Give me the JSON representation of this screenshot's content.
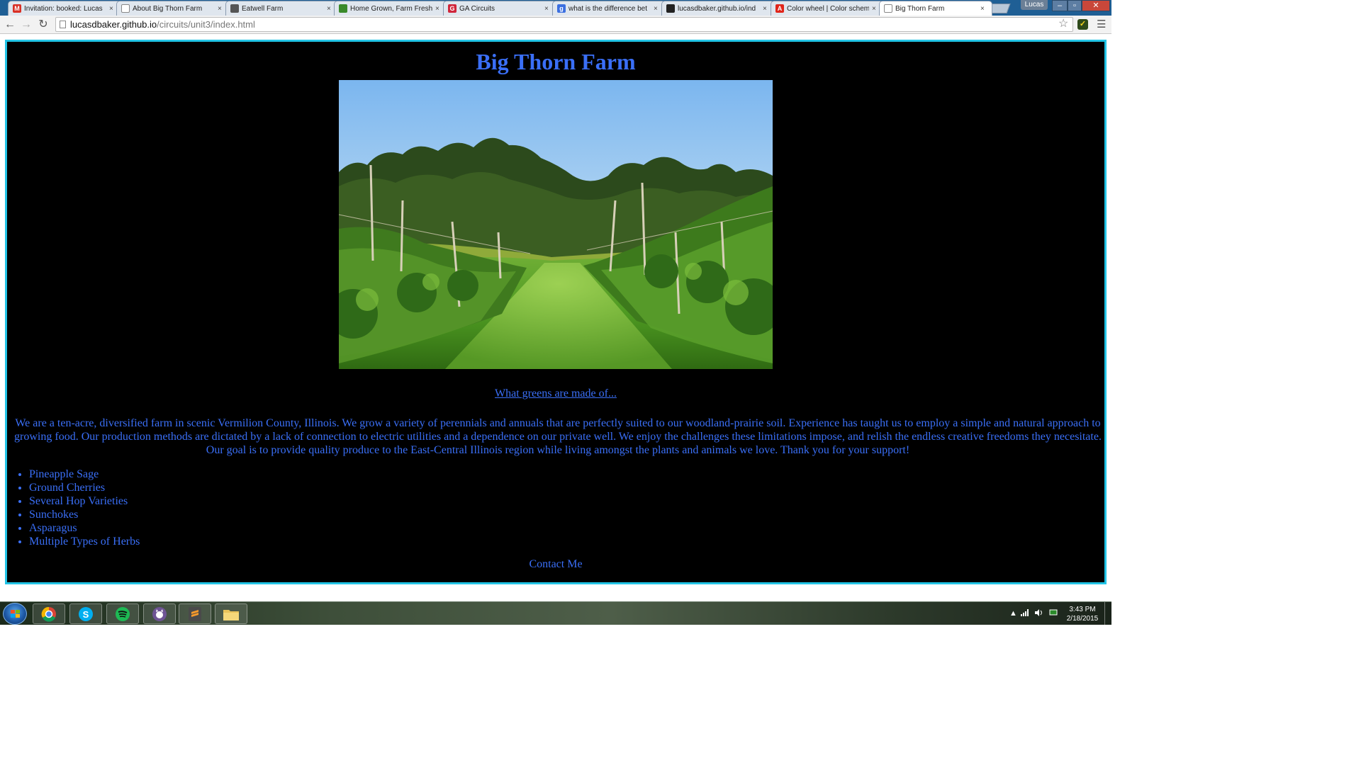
{
  "browser": {
    "tabs": [
      {
        "label": "Invitation: booked: Lucas",
        "favicon": "gmail-icon",
        "color": "#d93025",
        "glyph": "M"
      },
      {
        "label": "About Big Thorn Farm",
        "favicon": "page-icon",
        "color": "#ffffff",
        "glyph": ""
      },
      {
        "label": "Eatwell Farm",
        "favicon": "box-icon",
        "color": "#555555",
        "glyph": ""
      },
      {
        "label": "Home Grown, Farm Fresh",
        "favicon": "leaf-icon",
        "color": "#3a8a2a",
        "glyph": ""
      },
      {
        "label": "GA Circuits",
        "favicon": "ga-icon",
        "color": "#d0263b",
        "glyph": "G"
      },
      {
        "label": "what is the difference bet",
        "favicon": "google-icon",
        "color": "#3b6fe0",
        "glyph": "g"
      },
      {
        "label": "lucasdbaker.github.io/ind",
        "favicon": "github-icon",
        "color": "#222222",
        "glyph": ""
      },
      {
        "label": "Color wheel | Color schem",
        "favicon": "adobe-icon",
        "color": "#e0261b",
        "glyph": "A"
      },
      {
        "label": "Big Thorn Farm",
        "favicon": "page-icon",
        "color": "#ffffff",
        "glyph": "",
        "active": true
      }
    ],
    "close_glyph": "×",
    "user": "Lucas",
    "window_controls": {
      "minimize": "–",
      "maximize": "▫",
      "close": "✕"
    },
    "nav": {
      "back": "←",
      "forward": "→",
      "reload": "↻"
    },
    "url_host": "lucasdbaker.github.io",
    "url_path": "/circuits/unit3/index.html",
    "bookmark_star": "☆",
    "extension_glyph": "✓",
    "menu_glyph": "☰"
  },
  "page": {
    "title": "Big Thorn Farm",
    "link_text": "What greens are made of...",
    "about": "We are a ten-acre, diversified farm in scenic Vermilion County, Illinois. We grow a variety of perennials and annuals that are perfectly suited to our woodland-prairie soil. Experience has taught us to employ a simple and natural approach to growing food. Our production methods are dictated by a lack of connection to electric utilities and a dependence on our private well. We enjoy the challenges these limitations impose, and relish the endless creative freedoms they necesitate. Our goal is to provide quality produce to the East-Central Illinois region while living amongst the plants and animals we love. Thank you for your support!",
    "crops": [
      "Pineapple Sage",
      "Ground Cherries",
      "Several Hop Varieties",
      "Sunchokes",
      "Asparagus",
      "Multiple Types of Herbs"
    ],
    "contact": "Contact Me",
    "colors": {
      "text": "#3a6ff7",
      "background": "#000000",
      "frame_border": "#22c4e6"
    }
  },
  "taskbar": {
    "apps": [
      "chrome-icon",
      "skype-icon",
      "spotify-icon",
      "github-desktop-icon",
      "sublime-text-icon",
      "file-explorer-icon"
    ],
    "time": "3:43 PM",
    "date": "2/18/2015",
    "tray_arrow": "▲"
  }
}
